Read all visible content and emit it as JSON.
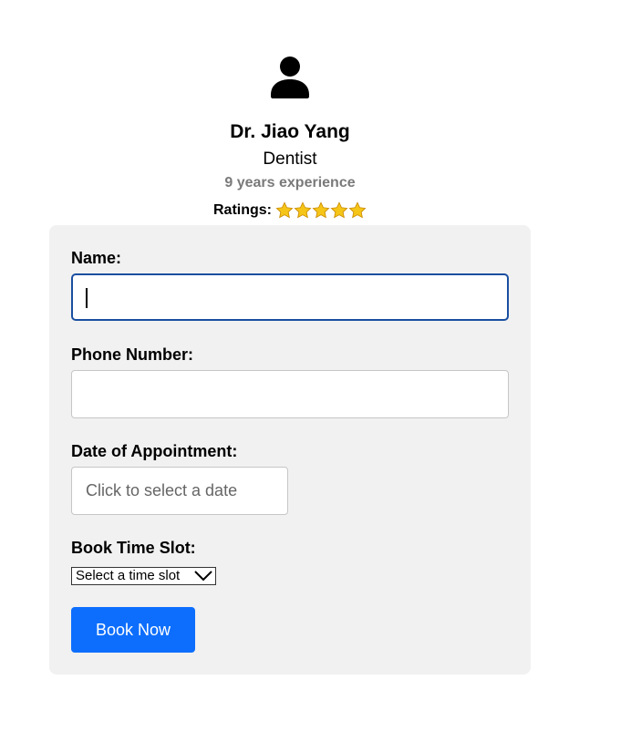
{
  "doctor": {
    "avatar_icon": "person-icon",
    "name": "Dr. Jiao Yang",
    "specialty": "Dentist",
    "experience": "9 years experience",
    "ratings_label": "Ratings:",
    "rating_stars": 5,
    "star_icon": "star-icon"
  },
  "form": {
    "name_label": "Name:",
    "name_value": "",
    "phone_label": "Phone Number:",
    "phone_value": "",
    "date_label": "Date of Appointment:",
    "date_placeholder": "Click to select a date",
    "timeslot_label": "Book Time Slot:",
    "timeslot_selected": "Select a time slot",
    "submit_label": "Book Now"
  },
  "colors": {
    "accent": "#0d6efd",
    "focus_border": "#1a4fa0",
    "card_bg": "#f1f1f1",
    "muted_text": "#7a7a7a",
    "star": "#f5c518"
  }
}
